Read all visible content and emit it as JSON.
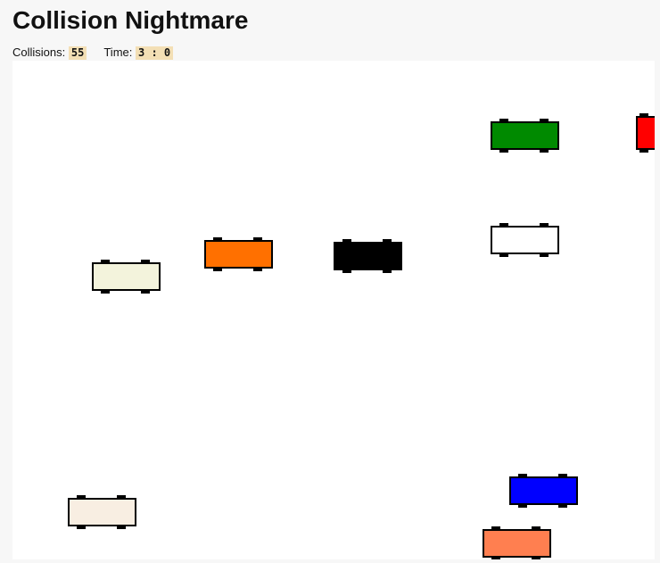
{
  "header": {
    "title": "Collision Nightmare",
    "collisions_label": "Collisions:",
    "collisions_value": "55",
    "time_label": "Time:",
    "time_value": "3 : 0"
  },
  "cars": [
    {
      "name": "car-green",
      "color": "#008a00"
    },
    {
      "name": "car-red",
      "color": "#ff0000"
    },
    {
      "name": "car-white",
      "color": "#ffffff"
    },
    {
      "name": "car-orange",
      "color": "#ff7000"
    },
    {
      "name": "car-black",
      "color": "#000000"
    },
    {
      "name": "car-beige",
      "color": "#f3f3dc"
    },
    {
      "name": "car-linen",
      "color": "#f8eee2"
    },
    {
      "name": "car-blue",
      "color": "#0000ff"
    },
    {
      "name": "car-coral",
      "color": "#ff7f50"
    }
  ]
}
